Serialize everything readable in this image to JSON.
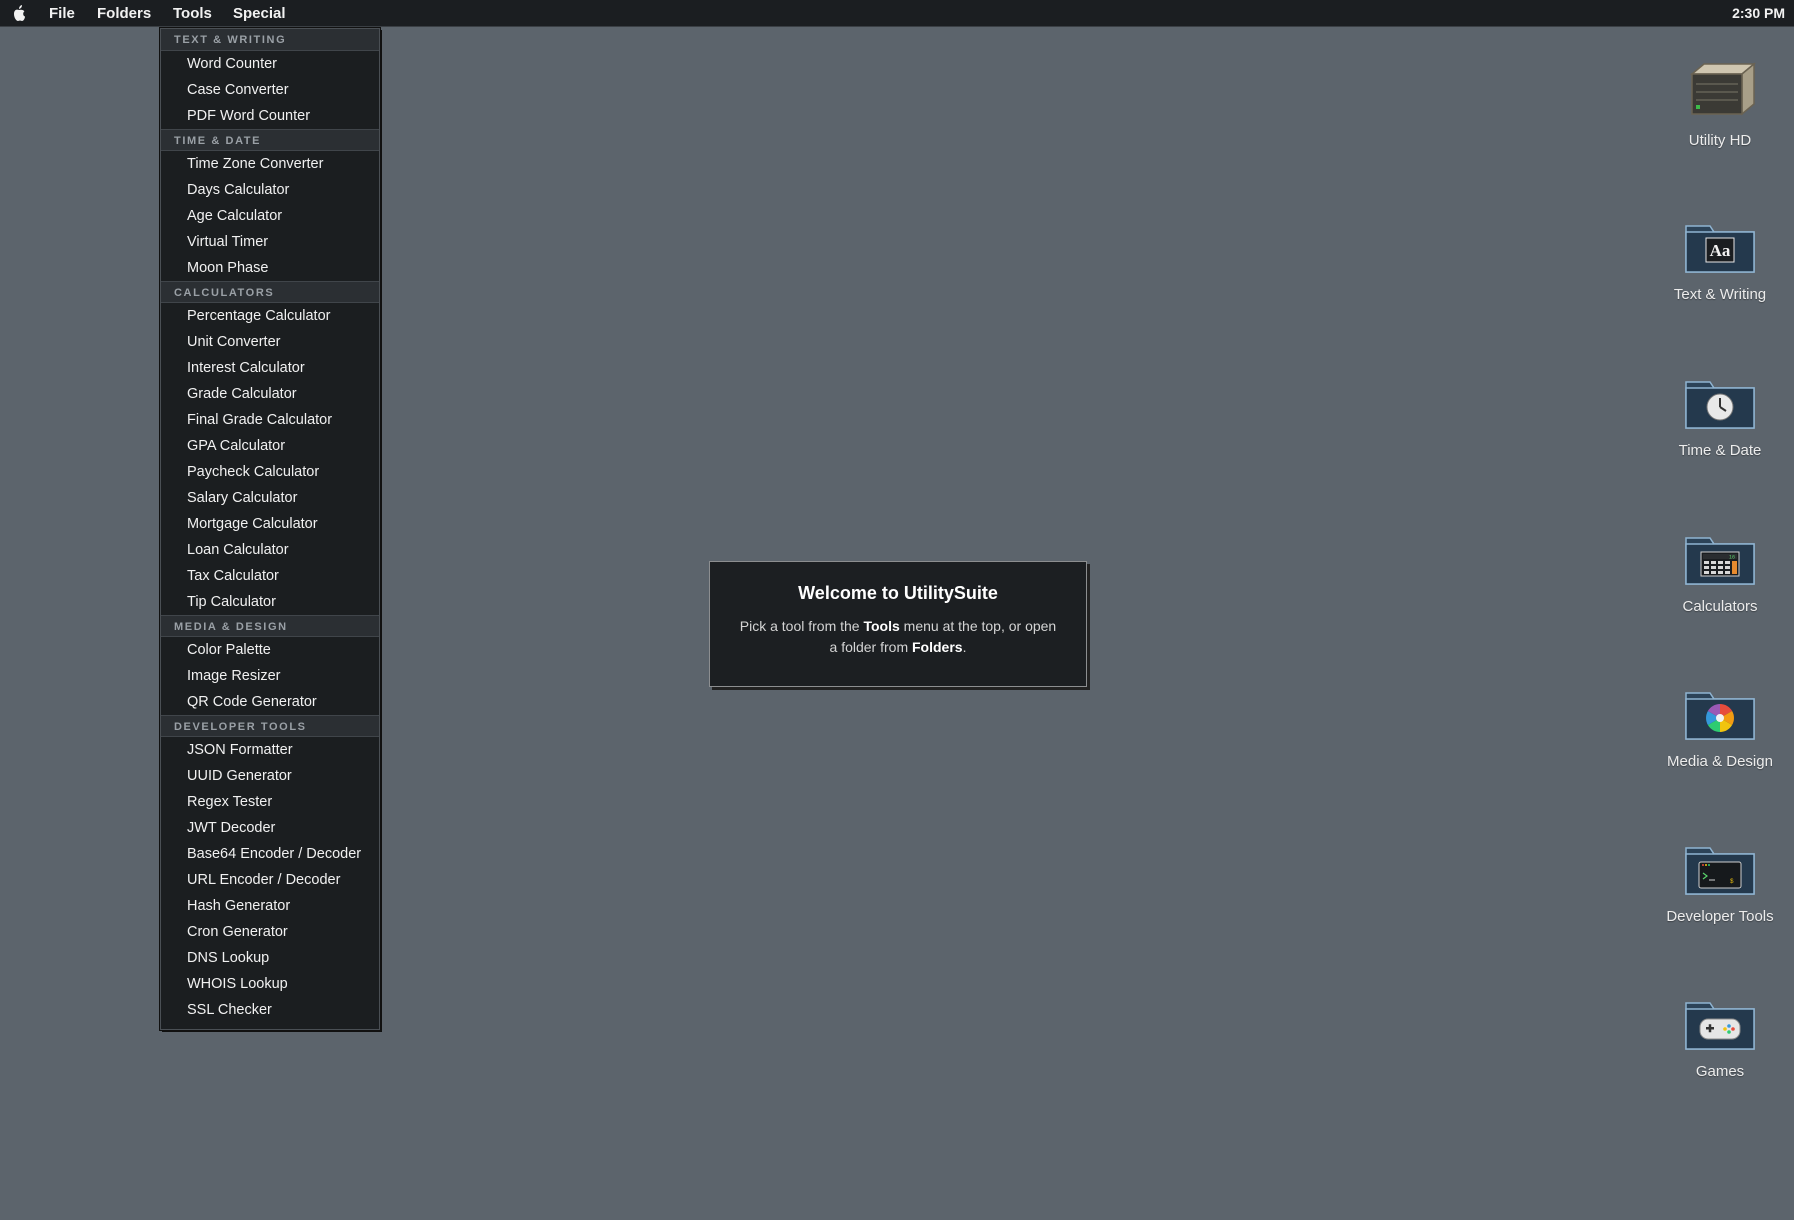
{
  "menubar": {
    "apple_icon": "apple-icon",
    "items": [
      "File",
      "Folders",
      "Tools",
      "Special"
    ],
    "clock": "2:30 PM"
  },
  "tools_menu": {
    "sections": [
      {
        "title": "TEXT & WRITING",
        "items": [
          "Word Counter",
          "Case Converter",
          "PDF Word Counter"
        ]
      },
      {
        "title": "TIME & DATE",
        "items": [
          "Time Zone Converter",
          "Days Calculator",
          "Age Calculator",
          "Virtual Timer",
          "Moon Phase"
        ]
      },
      {
        "title": "CALCULATORS",
        "items": [
          "Percentage Calculator",
          "Unit Converter",
          "Interest Calculator",
          "Grade Calculator",
          "Final Grade Calculator",
          "GPA Calculator",
          "Paycheck Calculator",
          "Salary Calculator",
          "Mortgage Calculator",
          "Loan Calculator",
          "Tax Calculator",
          "Tip Calculator"
        ]
      },
      {
        "title": "MEDIA & DESIGN",
        "items": [
          "Color Palette",
          "Image Resizer",
          "QR Code Generator"
        ]
      },
      {
        "title": "DEVELOPER TOOLS",
        "items": [
          "JSON Formatter",
          "UUID Generator",
          "Regex Tester",
          "JWT Decoder",
          "Base64 Encoder / Decoder",
          "URL Encoder / Decoder",
          "Hash Generator",
          "Cron Generator",
          "DNS Lookup",
          "WHOIS Lookup",
          "SSL Checker"
        ]
      }
    ]
  },
  "welcome": {
    "title": "Welcome to UtilitySuite",
    "line1_pre": "Pick a tool from the ",
    "line1_bold": "Tools",
    "line1_post": " menu at the top, or open",
    "line2_pre": "a folder from ",
    "line2_bold": "Folders",
    "line2_post": "."
  },
  "desktop_icons": [
    {
      "label": "Utility HD",
      "icon": "hard-drive-icon"
    },
    {
      "label": "Text & Writing",
      "icon": "folder-text-icon"
    },
    {
      "label": "Time & Date",
      "icon": "folder-clock-icon"
    },
    {
      "label": "Calculators",
      "icon": "folder-calculator-icon"
    },
    {
      "label": "Media & Design",
      "icon": "folder-color-wheel-icon"
    },
    {
      "label": "Developer Tools",
      "icon": "folder-terminal-icon"
    },
    {
      "label": "Games",
      "icon": "folder-gamepad-icon"
    }
  ],
  "colors": {
    "desktop": "#5c646c",
    "menubar": "#1b1e21",
    "menu_bg": "#1b1e20"
  }
}
